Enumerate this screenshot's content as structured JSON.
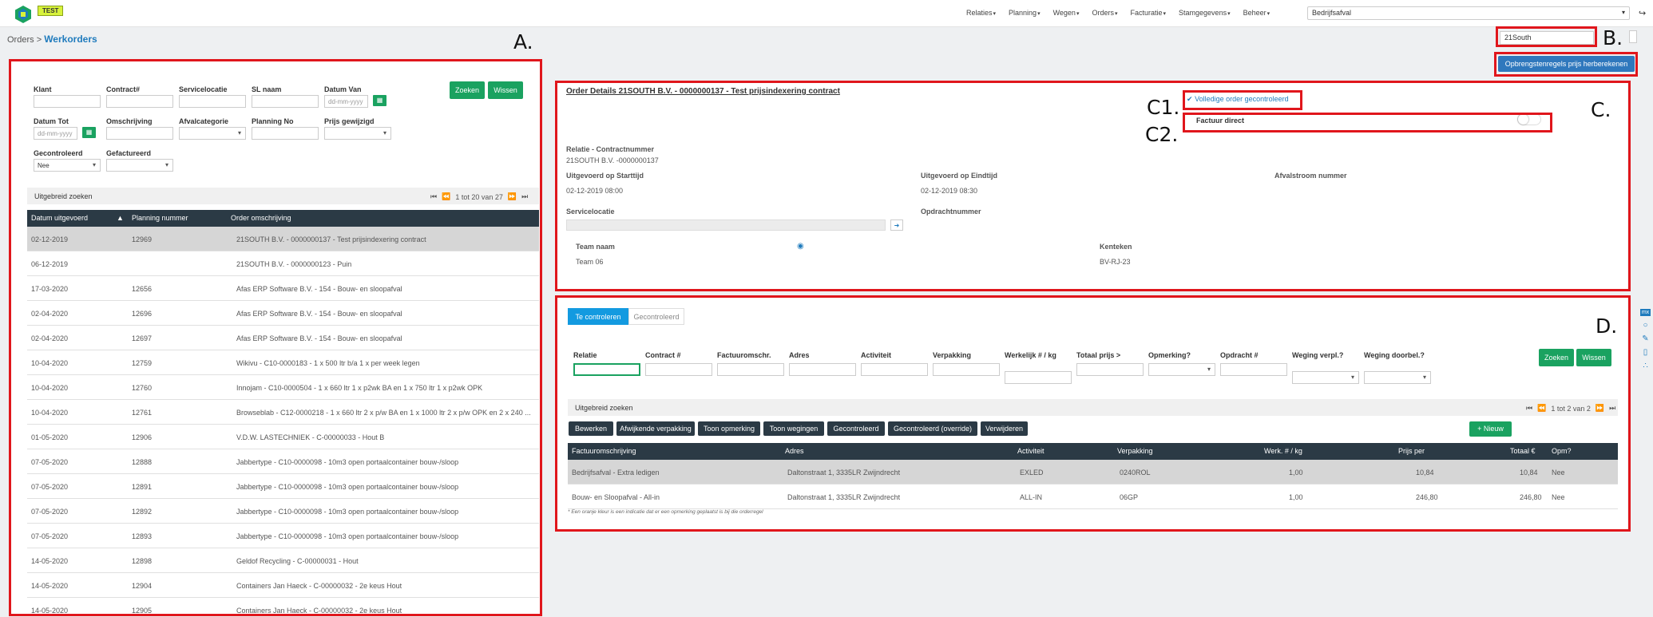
{
  "app": {
    "env_badge": "TEST",
    "nav": [
      "Relaties",
      "Planning",
      "Wegen",
      "Orders",
      "Facturatie",
      "Stamgegevens",
      "Beheer"
    ],
    "tenant": "Bedrijfsafval",
    "colors": {
      "primary": "#1f7bbd",
      "green": "#1aa260",
      "dark": "#2b3a45",
      "tab_active": "#139ae0",
      "annotation": "#e0161c"
    }
  },
  "breadcrumb": {
    "parent": "Orders",
    "sep": ">",
    "current": "Werkorders"
  },
  "global_search": {
    "value": "21South"
  },
  "recalc_button": "Opbrengstenregels prijs herberekenen",
  "markers": {
    "a": "A.",
    "b": "B.",
    "c": "C.",
    "c1": "C1.",
    "c2": "C2.",
    "d": "D."
  },
  "filters": {
    "klant": "Klant",
    "contract": "Contract#",
    "servicelocatie": "Servicelocatie",
    "sl_naam": "SL naam",
    "datum_van": "Datum Van",
    "datum_tot": "Datum Tot",
    "date_placeholder": "dd-mm-yyyy",
    "omschrijving": "Omschrijving",
    "afvalcategorie": "Afvalcategorie",
    "planning_no": "Planning No",
    "prijs_gewijzigd": "Prijs gewijzigd",
    "gecontroleerd": "Gecontroleerd",
    "gecontroleerd_value": "Nee",
    "gefactureerd": "Gefactureerd",
    "zoeken": "Zoeken",
    "wissen": "Wissen"
  },
  "left_list": {
    "extended_search": "Uitgebreid zoeken",
    "pager": "1 tot 20 van 27",
    "columns": [
      "Datum uitgevoerd",
      "Planning nummer",
      "Order omschrijving"
    ],
    "rows": [
      [
        "02-12-2019",
        "12969",
        "21SOUTH B.V. - 0000000137 - Test prijsindexering contract"
      ],
      [
        "06-12-2019",
        "",
        "21SOUTH B.V. - 0000000123 - Puin"
      ],
      [
        "17-03-2020",
        "12656",
        "Afas ERP Software B.V. - 154 - Bouw- en sloopafval"
      ],
      [
        "02-04-2020",
        "12696",
        "Afas ERP Software B.V. - 154 - Bouw- en sloopafval"
      ],
      [
        "02-04-2020",
        "12697",
        "Afas ERP Software B.V. - 154 - Bouw- en sloopafval"
      ],
      [
        "10-04-2020",
        "12759",
        "Wikivu - C10-0000183 - 1 x 500 ltr b/a 1 x per week legen"
      ],
      [
        "10-04-2020",
        "12760",
        "Innojam - C10-0000504 - 1 x 660 ltr 1 x p2wk BA en 1 x 750 ltr 1 x p2wk OPK"
      ],
      [
        "10-04-2020",
        "12761",
        "Browseblab - C12-0000218 - 1 x 660 ltr 2 x p/w BA en 1 x 1000 ltr 2 x p/w OPK en 2 x 240 ..."
      ],
      [
        "01-05-2020",
        "12906",
        "V.D.W. LASTECHNIEK - C-00000033 - Hout B"
      ],
      [
        "07-05-2020",
        "12888",
        "Jabbertype - C10-0000098 - 10m3 open portaalcontainer bouw-/sloop"
      ],
      [
        "07-05-2020",
        "12891",
        "Jabbertype - C10-0000098 - 10m3 open portaalcontainer bouw-/sloop"
      ],
      [
        "07-05-2020",
        "12892",
        "Jabbertype - C10-0000098 - 10m3 open portaalcontainer bouw-/sloop"
      ],
      [
        "07-05-2020",
        "12893",
        "Jabbertype - C10-0000098 - 10m3 open portaalcontainer bouw-/sloop"
      ],
      [
        "14-05-2020",
        "12898",
        "Geldof Recycling - C-00000031 - Hout"
      ],
      [
        "14-05-2020",
        "12904",
        "Containers Jan Haeck - C-00000032 - 2e keus Hout"
      ],
      [
        "14-05-2020",
        "12905",
        "Containers Jan Haeck - C-00000032 - 2e keus Hout"
      ]
    ]
  },
  "detail": {
    "title": "Order Details 21SOUTH B.V. - 0000000137 - Test prijsindexering contract",
    "check_link": "Volledige order gecontroleerd",
    "factuur_direct": "Factuur direct",
    "relatie_label": "Relatie - Contractnummer",
    "relatie_value": "21SOUTH B.V. -0000000137",
    "start_label": "Uitgevoerd op Starttijd",
    "start_value": "02-12-2019 08:00",
    "end_label": "Uitgevoerd op Eindtijd",
    "end_value": "02-12-2019 08:30",
    "afvalstroom_label": "Afvalstroom nummer",
    "servicelocatie_label": "Servicelocatie",
    "opdrachtnummer_label": "Opdrachtnummer",
    "team_label": "Team naam",
    "team_value": "Team 06",
    "kenteken_label": "Kenteken",
    "kenteken_value": "BV-RJ-23"
  },
  "lines": {
    "tabs": [
      "Te controleren",
      "Gecontroleerd"
    ],
    "filter_labels": [
      "Relatie",
      "Contract #",
      "Factuuromschr.",
      "Adres",
      "Activiteit",
      "Verpakking",
      "Werkelijk # / kg",
      "Totaal prijs >",
      "Opmerking?",
      "Opdracht #",
      "Weging verpl.?",
      "Weging doorbel.?"
    ],
    "zoeken": "Zoeken",
    "wissen": "Wissen",
    "extended_search": "Uitgebreid zoeken",
    "pager": "1 tot 2 van 2",
    "actions": [
      "Bewerken",
      "Afwijkende verpakking",
      "Toon opmerking",
      "Toon wegingen",
      "Gecontroleerd",
      "Gecontroleerd (override)",
      "Verwijderen"
    ],
    "new_button": "+ Nieuw",
    "columns": [
      "Factuuromschrijving",
      "Adres",
      "Activiteit",
      "Verpakking",
      "Werk. # / kg",
      "Prijs per",
      "Totaal €",
      "Opm?"
    ],
    "rows": [
      [
        "Bedrijfsafval - Extra ledigen",
        "Daltonstraat 1, 3335LR Zwijndrecht",
        "EXLED",
        "0240ROL",
        "1,00",
        "10,84",
        "10,84",
        "Nee"
      ],
      [
        "Bouw- en Sloopafval - All-in",
        "Daltonstraat 1, 3335LR Zwijndrecht",
        "ALL-IN",
        "06GP",
        "1,00",
        "246,80",
        "246,80",
        "Nee"
      ]
    ],
    "note": "* Een oranje kleur is een indicatie dat er een opmerking geplaatst is bij die orderregel"
  },
  "side_icons": [
    "mx-icon",
    "chat-icon",
    "pencil-icon",
    "phone-icon",
    "share-icon"
  ]
}
